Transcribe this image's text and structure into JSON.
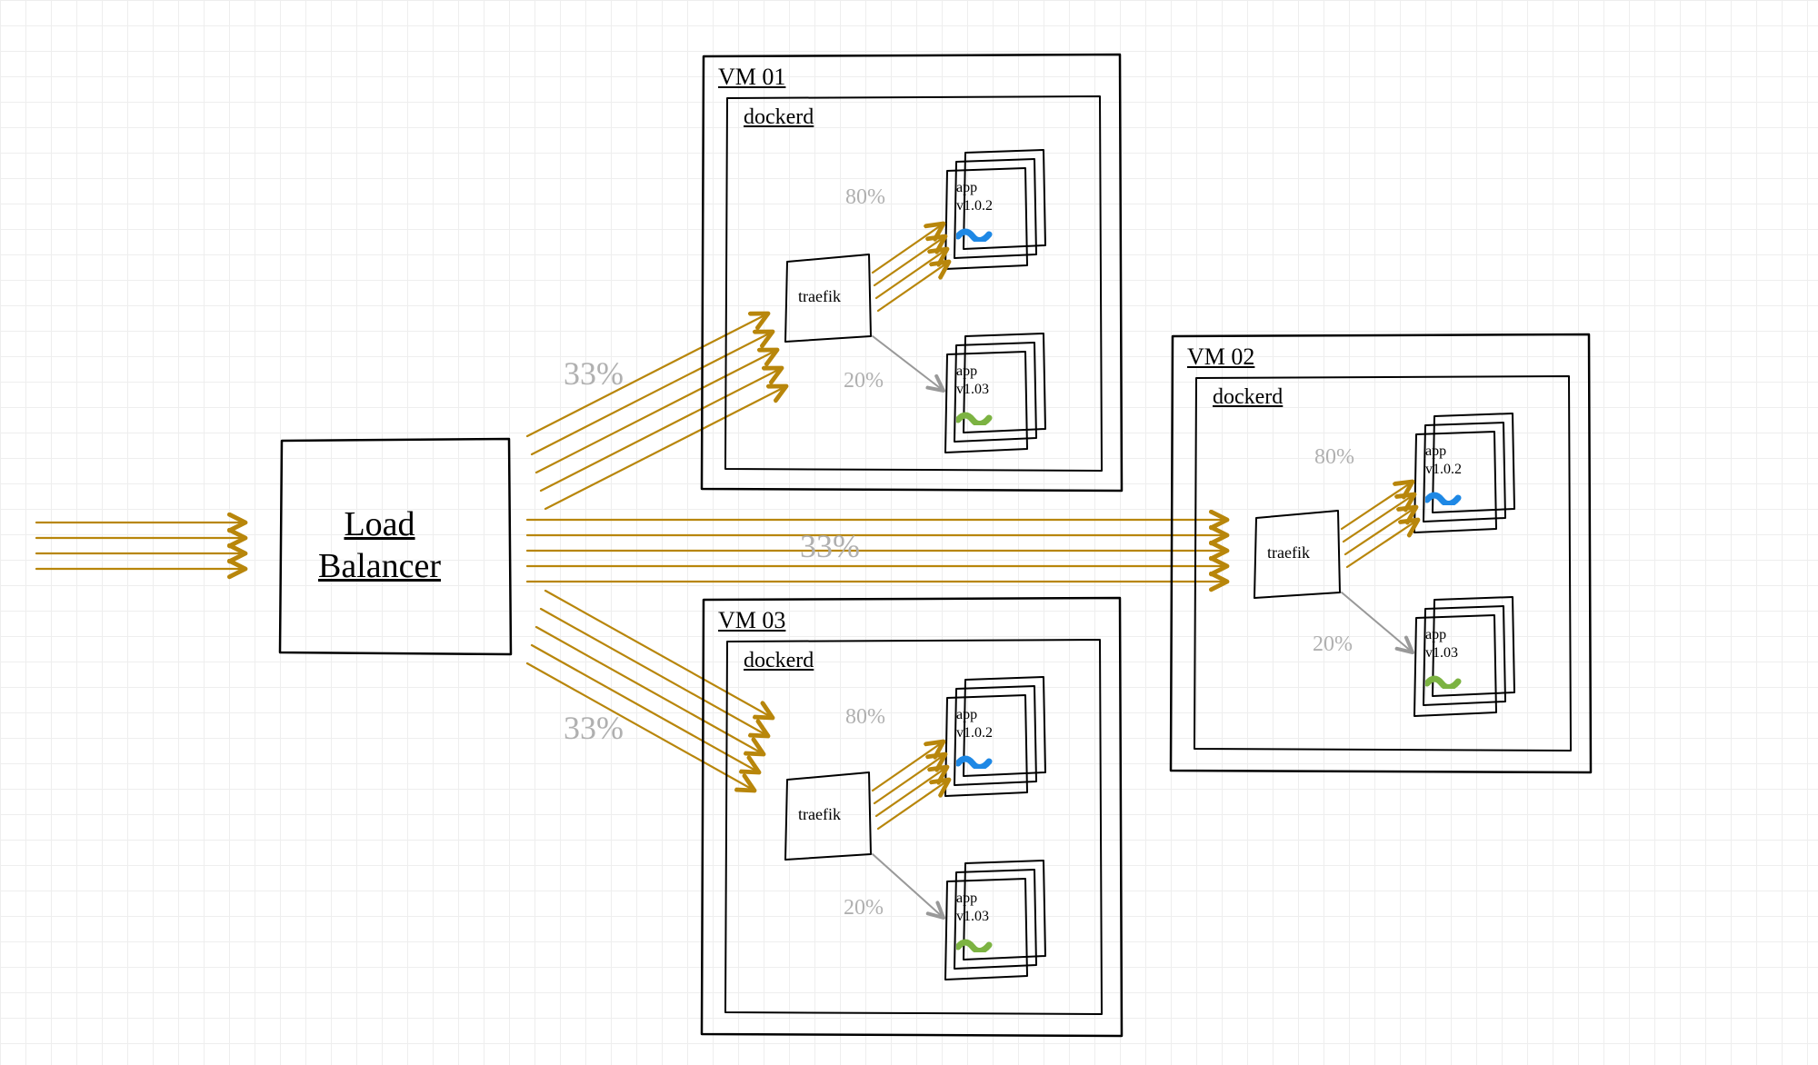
{
  "load_balancer": {
    "label": "Load\nBalancer"
  },
  "lb_to_vm_pct": {
    "vm01": "33%",
    "vm02": "33%",
    "vm03": "33%"
  },
  "vms": [
    {
      "id": "vm01",
      "label": "VM 01",
      "dockerd": "dockerd",
      "traefik": "traefik",
      "apps": [
        {
          "name": "app",
          "version": "v1.0.2",
          "pct": "80%",
          "color": "blue"
        },
        {
          "name": "app",
          "version": "v1.03",
          "pct": "20%",
          "color": "green"
        }
      ]
    },
    {
      "id": "vm02",
      "label": "VM 02",
      "dockerd": "dockerd",
      "traefik": "traefik",
      "apps": [
        {
          "name": "app",
          "version": "v1.0.2",
          "pct": "80%",
          "color": "blue"
        },
        {
          "name": "app",
          "version": "v1.03",
          "pct": "20%",
          "color": "green"
        }
      ]
    },
    {
      "id": "vm03",
      "label": "VM 03",
      "dockerd": "dockerd",
      "traefik": "traefik",
      "apps": [
        {
          "name": "app",
          "version": "v1.0.2",
          "pct": "80%",
          "color": "blue"
        },
        {
          "name": "app",
          "version": "v1.03",
          "pct": "20%",
          "color": "green"
        }
      ]
    }
  ]
}
